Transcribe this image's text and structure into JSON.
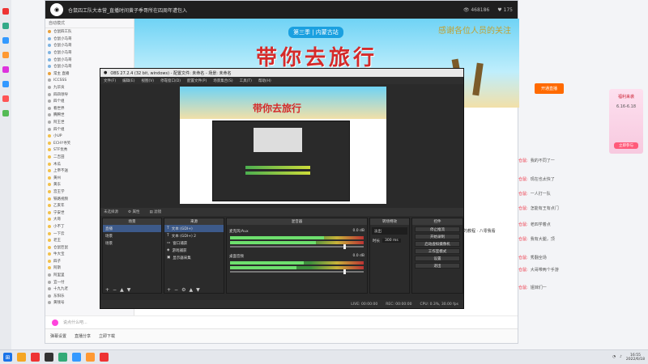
{
  "stream_window": {
    "title": "仓鼠四工队大本营_直播时间黄子季哥所在四周年遭包入",
    "viewers": "468186",
    "followers": "175",
    "banner_season": "第三季 | 内蒙古站",
    "banner_title": "带你去旅行",
    "banner_thanks": "感谢各位人员的关注",
    "chat_input_placeholder": "说点什么吧...",
    "bottom_items": [
      "弹幕设置",
      "直播分享",
      "立即下载"
    ]
  },
  "userlist": {
    "header": "自动模式",
    "items": [
      {
        "name": "仓鼠四工队",
        "color": "#e9a13b"
      },
      {
        "name": "仓鼠小马哥",
        "color": "#7fb3e0"
      },
      {
        "name": "仓鼠小马哥",
        "color": "#7fb3e0"
      },
      {
        "name": "仓鼠小马哥",
        "color": "#7fb3e0"
      },
      {
        "name": "仓鼠小马哥",
        "color": "#7fb3e0"
      },
      {
        "name": "仓鼠小马哥",
        "color": "#7fb3e0"
      },
      {
        "name": "常主 直播",
        "color": "#e9a13b"
      },
      {
        "name": "ICCSSS",
        "color": "#aaa"
      },
      {
        "name": "九华贡",
        "color": "#aaa"
      },
      {
        "name": "四四领导",
        "color": "#aaa"
      },
      {
        "name": "四个组",
        "color": "#aaa"
      },
      {
        "name": "看世界",
        "color": "#aaa"
      },
      {
        "name": "腾腾世",
        "color": "#aaa"
      },
      {
        "name": "阿王世",
        "color": "#aaa"
      },
      {
        "name": "四个组",
        "color": "#aaa"
      },
      {
        "name": "小UP",
        "color": "#f2c14a"
      },
      {
        "name": "ECHY寻笑",
        "color": "#f2c14a"
      },
      {
        "name": "STF优秀",
        "color": "#f2c14a"
      },
      {
        "name": "二吉田",
        "color": "#f2c14a"
      },
      {
        "name": "木瓜",
        "color": "#f2c14a"
      },
      {
        "name": "上帝不送",
        "color": "#f2c14a"
      },
      {
        "name": "黄州",
        "color": "#f2c14a"
      },
      {
        "name": "黄东",
        "color": "#f2c14a"
      },
      {
        "name": "宫王学",
        "color": "#f2c14a"
      },
      {
        "name": "铁路视频",
        "color": "#f2c14a"
      },
      {
        "name": "乙亥年",
        "color": "#f2c14a"
      },
      {
        "name": "宁安世",
        "color": "#f2c14a"
      },
      {
        "name": "大哥",
        "color": "#f2c14a"
      },
      {
        "name": "小不丁",
        "color": "#f2c14a"
      },
      {
        "name": "一下云",
        "color": "#f2c14a"
      },
      {
        "name": "老王",
        "color": "#f2c14a"
      },
      {
        "name": "仓鼠巨鼠",
        "color": "#f2c14a"
      },
      {
        "name": "牛大宝",
        "color": "#f2c14a"
      },
      {
        "name": "四子",
        "color": "#f2c14a"
      },
      {
        "name": "阿斯",
        "color": "#f2c14a"
      },
      {
        "name": "阿里里",
        "color": "#aaa"
      },
      {
        "name": "宜一付",
        "color": "#aaa"
      },
      {
        "name": "十九九老",
        "color": "#aaa"
      },
      {
        "name": "东阳乐",
        "color": "#aaa"
      },
      {
        "name": "黄钱号",
        "color": "#aaa"
      }
    ]
  },
  "obs": {
    "title": "OBS 27.2.4 (32 bit, windows) - 配置文件: 未命名 - 场景: 未命名",
    "menu": [
      "文件(F)",
      "编辑(E)",
      "视图(V)",
      "停靠窗口(D)",
      "配置文件(P)",
      "场景集合(S)",
      "工具(T)",
      "帮助(H)"
    ],
    "panels_bar": [
      "未选择源",
      "属性",
      "滤镜"
    ],
    "docks": {
      "scenes": {
        "title": "场景",
        "items": [
          "直播",
          "场景",
          "场景"
        ]
      },
      "sources": {
        "title": "来源",
        "items": [
          "文本 (GDI+)",
          "文本 (GDI+) 2",
          "窗口捕获",
          "游戏捕获",
          "显示器采集"
        ]
      },
      "mixer": {
        "title": "混音器",
        "channels": [
          {
            "name": "麦克风/Aux",
            "db": "0.0 dB",
            "level": 0.7
          },
          {
            "name": "桌面音频",
            "db": "0.0 dB",
            "level": 0.55
          }
        ]
      },
      "transitions": {
        "title": "转场特效",
        "type": "淡出",
        "duration_label": "时长",
        "duration": "300 ms"
      },
      "controls": {
        "title": "控件",
        "buttons": [
          "停止推流",
          "开始录制",
          "启动虚拟摄像机",
          "工作室模式",
          "设置",
          "退出"
        ]
      }
    },
    "status": [
      "LIVE: 00:00:00",
      "REC: 00:00:00",
      "CPU: 0.3%, 30.00 fps"
    ]
  },
  "right_chat": {
    "button": "开通直播",
    "messages": [
      {
        "name": "仓鼠:",
        "text": "我的不同了一"
      },
      {
        "name": "仓鼠:",
        "text": "现在也太快了"
      },
      {
        "name": "仓鼠:",
        "text": "一人打一队"
      },
      {
        "name": "仓鼠:",
        "text": "怎能有王有点门"
      },
      {
        "name": "仓鼠:",
        "text": "老四学着点"
      },
      {
        "name": "仓鼠:",
        "text": "我有大腿，顶"
      },
      {
        "name": "仓鼠:",
        "text": "秀翻全场"
      },
      {
        "name": "仓鼠:",
        "text": "大哥带两个手游"
      },
      {
        "name": "仓鼠:",
        "text": "姐妹们一"
      }
    ],
    "overlay_text": "的教程 · 八零我看"
  },
  "promo": {
    "title": "福利来袭",
    "dates": "6.16-6.18",
    "button": "立即参与"
  },
  "taskbar": {
    "time": "16:55",
    "date": "2022/6/18"
  }
}
